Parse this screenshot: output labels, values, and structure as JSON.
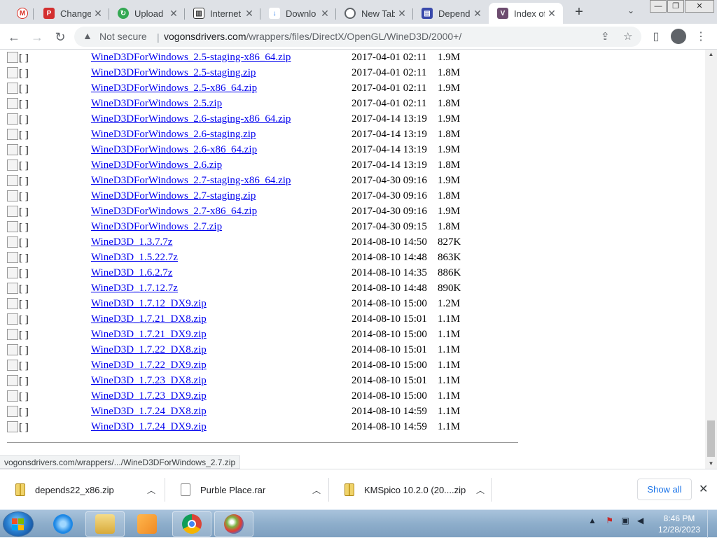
{
  "tabs": [
    {
      "title": "",
      "favicon": "gmail-icon",
      "color": "#d93025",
      "letter": "M"
    },
    {
      "title": "Change",
      "favicon": "pdf-icon",
      "color": "#d32f2f",
      "letter": "P"
    },
    {
      "title": "Upload",
      "favicon": "refresh-icon",
      "color": "#34a853",
      "letter": "↻"
    },
    {
      "title": "Internet",
      "favicon": "archive-icon",
      "color": "#333333",
      "letter": "▥"
    },
    {
      "title": "Downlo",
      "favicon": "download-icon",
      "color": "#1a73e8",
      "letter": "↓"
    },
    {
      "title": "New Tab",
      "favicon": "chrome-icon",
      "color": "#5f6368",
      "letter": "◎"
    },
    {
      "title": "Depend",
      "favicon": "depends-icon",
      "color": "#3949ab",
      "letter": "▤"
    },
    {
      "title": "Index of",
      "favicon": "vogons-icon",
      "color": "#6d4c6f",
      "letter": "V"
    }
  ],
  "window_controls": {
    "minimize": "—",
    "maximize": "❐",
    "close": "✕"
  },
  "address_bar": {
    "security_label": "Not secure",
    "url_domain": "vogonsdrivers.com",
    "url_path": "/wrappers/files/DirectX/OpenGL/WineD3D/2000+/"
  },
  "listing": {
    "broken_image_text": "[ ]",
    "files": [
      {
        "name": "WineD3DForWindows_2.5-staging-x86_64.zip",
        "date": "2017-04-01 02:11",
        "size": "1.9M"
      },
      {
        "name": "WineD3DForWindows_2.5-staging.zip",
        "date": "2017-04-01 02:11",
        "size": "1.8M"
      },
      {
        "name": "WineD3DForWindows_2.5-x86_64.zip",
        "date": "2017-04-01 02:11",
        "size": "1.9M"
      },
      {
        "name": "WineD3DForWindows_2.5.zip",
        "date": "2017-04-01 02:11",
        "size": "1.8M"
      },
      {
        "name": "WineD3DForWindows_2.6-staging-x86_64.zip",
        "date": "2017-04-14 13:19",
        "size": "1.9M"
      },
      {
        "name": "WineD3DForWindows_2.6-staging.zip",
        "date": "2017-04-14 13:19",
        "size": "1.8M"
      },
      {
        "name": "WineD3DForWindows_2.6-x86_64.zip",
        "date": "2017-04-14 13:19",
        "size": "1.9M"
      },
      {
        "name": "WineD3DForWindows_2.6.zip",
        "date": "2017-04-14 13:19",
        "size": "1.8M"
      },
      {
        "name": "WineD3DForWindows_2.7-staging-x86_64.zip",
        "date": "2017-04-30 09:16",
        "size": "1.9M"
      },
      {
        "name": "WineD3DForWindows_2.7-staging.zip",
        "date": "2017-04-30 09:16",
        "size": "1.8M"
      },
      {
        "name": "WineD3DForWindows_2.7-x86_64.zip",
        "date": "2017-04-30 09:16",
        "size": "1.9M"
      },
      {
        "name": "WineD3DForWindows_2.7.zip",
        "date": "2017-04-30 09:15",
        "size": "1.8M"
      },
      {
        "name": "WineD3D_1.3.7.7z",
        "date": "2014-08-10 14:50",
        "size": "827K"
      },
      {
        "name": "WineD3D_1.5.22.7z",
        "date": "2014-08-10 14:48",
        "size": "863K"
      },
      {
        "name": "WineD3D_1.6.2.7z",
        "date": "2014-08-10 14:35",
        "size": "886K"
      },
      {
        "name": "WineD3D_1.7.12.7z",
        "date": "2014-08-10 14:48",
        "size": "890K"
      },
      {
        "name": "WineD3D_1.7.12_DX9.zip",
        "date": "2014-08-10 15:00",
        "size": "1.2M"
      },
      {
        "name": "WineD3D_1.7.21_DX8.zip",
        "date": "2014-08-10 15:01",
        "size": "1.1M"
      },
      {
        "name": "WineD3D_1.7.21_DX9.zip",
        "date": "2014-08-10 15:00",
        "size": "1.1M"
      },
      {
        "name": "WineD3D_1.7.22_DX8.zip",
        "date": "2014-08-10 15:01",
        "size": "1.1M"
      },
      {
        "name": "WineD3D_1.7.22_DX9.zip",
        "date": "2014-08-10 15:00",
        "size": "1.1M"
      },
      {
        "name": "WineD3D_1.7.23_DX8.zip",
        "date": "2014-08-10 15:01",
        "size": "1.1M"
      },
      {
        "name": "WineD3D_1.7.23_DX9.zip",
        "date": "2014-08-10 15:00",
        "size": "1.1M"
      },
      {
        "name": "WineD3D_1.7.24_DX8.zip",
        "date": "2014-08-10 14:59",
        "size": "1.1M"
      },
      {
        "name": "WineD3D_1.7.24_DX9.zip",
        "date": "2014-08-10 14:59",
        "size": "1.1M"
      }
    ]
  },
  "status_link": "vogonsdrivers.com/wrappers/.../WineD3DForWindows_2.7.zip",
  "downloads": {
    "items": [
      {
        "name": "depends22_x86.zip",
        "type": "zip"
      },
      {
        "name": "Purble Place.rar",
        "type": "rar"
      },
      {
        "name": "KMSpico 10.2.0 (20....zip",
        "type": "zip"
      }
    ],
    "show_all_label": "Show all"
  },
  "taskbar": {
    "apps": [
      {
        "name": "internet-explorer-icon",
        "color": "#1e88e5"
      },
      {
        "name": "file-explorer-icon",
        "color": "#e8c25a"
      },
      {
        "name": "media-player-icon",
        "color": "#f08a24"
      },
      {
        "name": "chrome-icon",
        "color": "#db4437"
      },
      {
        "name": "paint-icon",
        "color": "#7cb342"
      }
    ],
    "time": "8:46 PM",
    "date": "12/28/2023"
  }
}
